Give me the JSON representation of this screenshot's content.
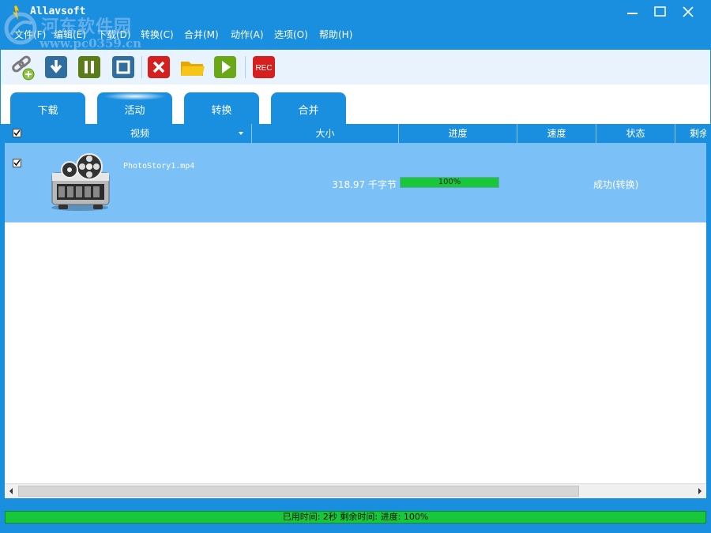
{
  "window": {
    "title": "Allavsoft"
  },
  "watermark": {
    "line1": "河东软件园",
    "line2": "www.pc0359.cn"
  },
  "menu": {
    "items": [
      "文件(F)",
      "编辑(E)",
      "下载(D)",
      "转换(C)",
      "合并(M)",
      "动作(A)",
      "选项(O)",
      "帮助(H)"
    ]
  },
  "toolbar": {
    "buttons": [
      {
        "name": "add-link",
        "icon": "link-add-icon"
      },
      {
        "name": "download",
        "icon": "download-arrow-icon",
        "color": "#2f6e9e"
      },
      {
        "name": "pause",
        "icon": "pause-icon",
        "color": "#5a7d1a"
      },
      {
        "name": "stop",
        "icon": "stop-icon",
        "color": "#2f6e9e"
      },
      {
        "name": "delete",
        "icon": "close-x-icon",
        "color": "#d62020"
      },
      {
        "name": "open-folder",
        "icon": "folder-icon",
        "color": "#f0b400"
      },
      {
        "name": "play",
        "icon": "play-icon",
        "color": "#6aa818"
      },
      {
        "name": "record",
        "icon": "rec-icon",
        "label": "REC",
        "color": "#d62020"
      }
    ]
  },
  "tabs": [
    {
      "label": "下载",
      "active": false
    },
    {
      "label": "活动",
      "active": true
    },
    {
      "label": "转换",
      "active": false
    },
    {
      "label": "合并",
      "active": false
    }
  ],
  "table": {
    "columns": [
      "视频",
      "大小",
      "进度",
      "速度",
      "状态",
      "剩余"
    ],
    "rows": [
      {
        "checked": true,
        "filename": "PhotoStory1.mp4",
        "size": "318.97 千字节",
        "progress": 100,
        "progress_text": "100%",
        "speed": "",
        "status": "成功(转换)"
      }
    ]
  },
  "statusbar": {
    "text": "已用时间: 2秒 剩余时间: 进度: 100%"
  },
  "colors": {
    "accent": "#1a8fe0",
    "row_selected": "#7cc0f8",
    "progress": "#18c83a"
  }
}
